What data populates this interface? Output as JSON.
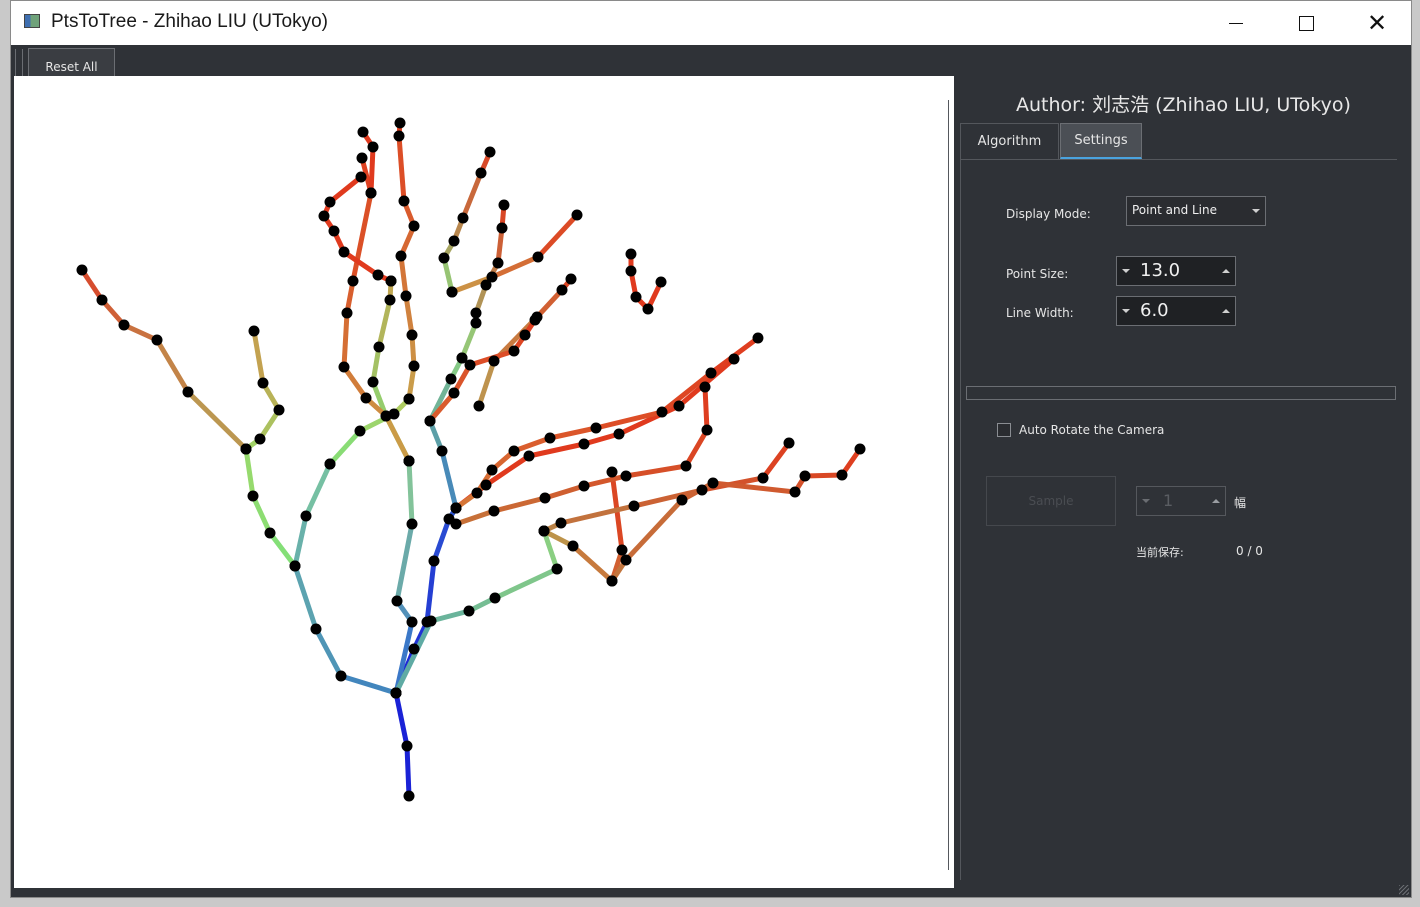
{
  "window": {
    "title": "PtsToTree - Zhihao LIU (UTokyo)",
    "minimize_icon": "minimize-icon",
    "maximize_icon": "maximize-icon",
    "close_icon": "close-icon",
    "close_glyph": "✕"
  },
  "toolbar": {
    "reset_label": "Reset All"
  },
  "panel": {
    "author": "Author: 刘志浩 (Zhihao LIU, UTokyo)",
    "tabs": [
      {
        "label": "Algorithm",
        "active": false
      },
      {
        "label": "Settings",
        "active": true
      }
    ],
    "settings": {
      "display_mode_label": "Display Mode:",
      "display_mode_value": "Point and Line",
      "point_size_label": "Point Size:",
      "point_size_value": "13.0",
      "line_width_label": "Line Width:",
      "line_width_value": "6.0",
      "auto_rotate_label": "Auto Rotate the Camera",
      "auto_rotate_checked": false,
      "sample_label": "Sample",
      "sample_count_value": "1",
      "sample_unit": "幅",
      "saved_label": "当前保存:",
      "saved_value": "0 / 0"
    }
  },
  "colors": {
    "panel_bg": "#2f3237",
    "accent": "#4aa3df",
    "trunk_blue": "#1a22d6",
    "branch_green": "#8de37a",
    "branch_red": "#e03a1e",
    "node": "#000000"
  }
}
